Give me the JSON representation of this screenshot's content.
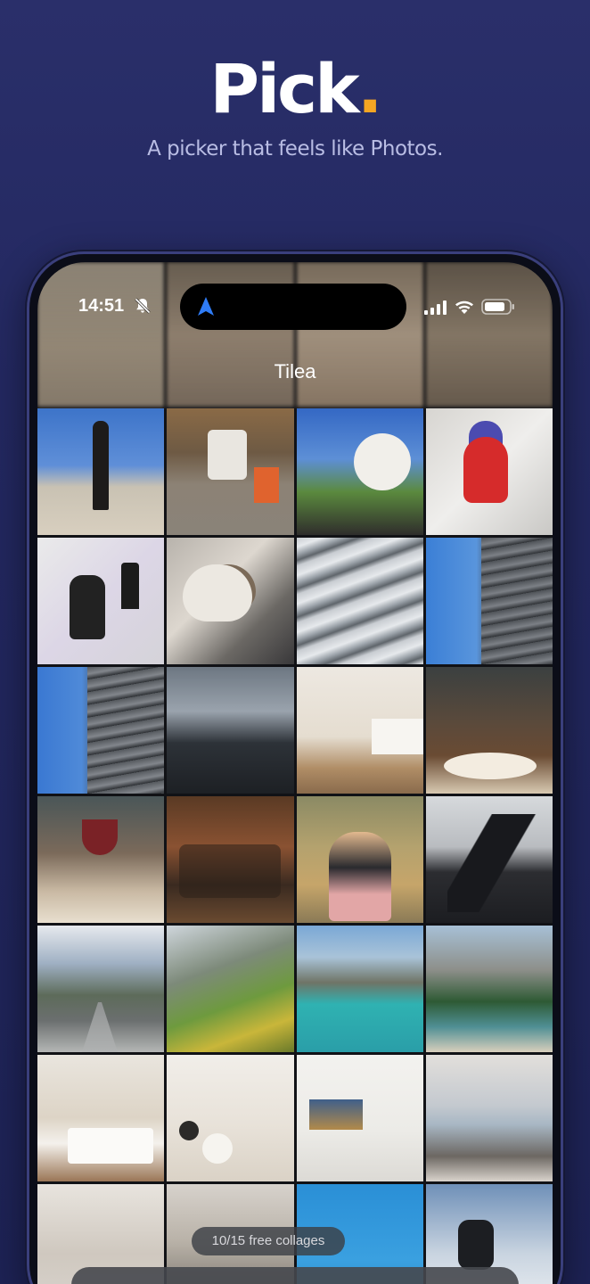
{
  "hero": {
    "title": "Pick",
    "title_dot": ".",
    "subtitle": "A picker that feels like Photos.",
    "accent_color": "#f5a623"
  },
  "status_bar": {
    "time": "14:51",
    "icons": [
      "bell-slash-icon",
      "location-arrow-icon",
      "cellular-signal-icon",
      "wifi-icon",
      "battery-icon"
    ]
  },
  "album": {
    "title": "Tilea"
  },
  "grid": {
    "photos": [
      "statue-plaza",
      "tuk-tuk-street",
      "white-dog-lawn",
      "child-drawing-ladybug",
      "child-drawing-cat",
      "sleeping-cat-laptop",
      "hexagon-facade",
      "building-facade-blue-sky",
      "building-facade-angle",
      "geometric-roof-clouds",
      "bright-living-room",
      "wine-toast-dinner",
      "wine-toast-table",
      "friends-cafe-toast",
      "kids-hugging-field",
      "stretching-group",
      "mountain-road",
      "alpine-meadow",
      "turquoise-lake-boat",
      "lake-forest-mountains",
      "bedroom-white",
      "living-room-armchair",
      "living-room-tv",
      "living-room-window",
      "living-room-art",
      "snowy-cliffs",
      "blue-sky-lift",
      "skier-jump"
    ]
  },
  "footer": {
    "collage_counter": "10/15 free collages"
  }
}
